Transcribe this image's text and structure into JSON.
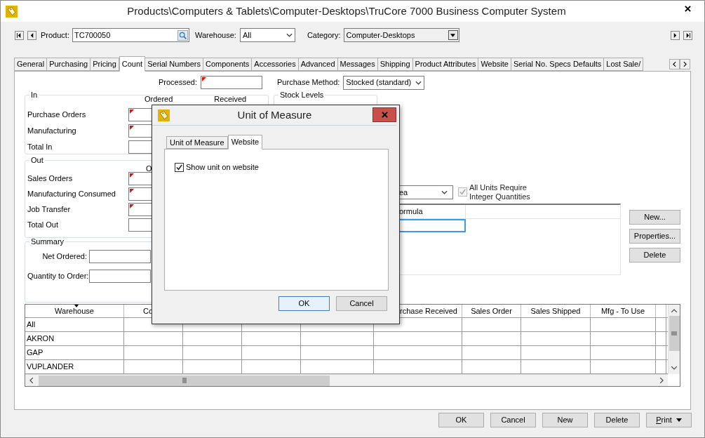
{
  "window": {
    "title": "Products\\Computers & Tablets\\Computer-Desktops\\TruCore 7000 Business Computer System"
  },
  "toolbar": {
    "product_label": "Product:",
    "product_value": "TC700050",
    "warehouse_label": "Warehouse:",
    "warehouse_value": "All",
    "category_label": "Category:",
    "category_value": "Computer-Desktops"
  },
  "tabs": [
    {
      "label": "General",
      "selected": false
    },
    {
      "label": "Purchasing",
      "selected": false
    },
    {
      "label": "Pricing",
      "selected": false
    },
    {
      "label": "Count",
      "selected": true
    },
    {
      "label": "Serial Numbers",
      "selected": false
    },
    {
      "label": "Components",
      "selected": false
    },
    {
      "label": "Accessories",
      "selected": false
    },
    {
      "label": "Advanced",
      "selected": false
    },
    {
      "label": "Messages",
      "selected": false
    },
    {
      "label": "Shipping",
      "selected": false
    },
    {
      "label": "Product Attributes",
      "selected": false
    },
    {
      "label": "Website",
      "selected": false
    },
    {
      "label": "Serial No. Specs Defaults",
      "selected": false
    },
    {
      "label": "Lost Sale/",
      "selected": false
    }
  ],
  "count": {
    "processed_label": "Processed:",
    "purchase_method_label": "Purchase Method:",
    "purchase_method_value": "Stocked (standard)",
    "in_group": {
      "title": "In",
      "headers": [
        "Ordered",
        "Received"
      ],
      "rows": [
        {
          "label": "Purchase Orders",
          "flagged": true
        },
        {
          "label": "Manufacturing",
          "flagged": true
        },
        {
          "label": "Total In",
          "flagged": false
        }
      ]
    },
    "out_group": {
      "title": "Out",
      "headers": [
        "O"
      ],
      "rows": [
        {
          "label": "Sales Orders",
          "flagged": true
        },
        {
          "label": "Manufacturing Consumed",
          "flagged": true
        },
        {
          "label": "Job Transfer",
          "flagged": true
        },
        {
          "label": "Total Out",
          "flagged": false
        }
      ]
    },
    "summary": {
      "title": "Summary",
      "fields": [
        {
          "label": "Net Ordered:"
        },
        {
          "label": "Quantity to Order:"
        }
      ]
    },
    "stock_levels": {
      "title": "Stock Levels"
    },
    "unit_value": "ea",
    "integer_units": {
      "label_lines": [
        "All Units Require",
        "Integer Quantities"
      ],
      "checked": true,
      "disabled": true
    },
    "units_grid": {
      "header": "ormula"
    },
    "side_buttons": [
      "New...",
      "Properties...",
      "Delete"
    ]
  },
  "warehouse_table": {
    "columns": [
      {
        "label": "Warehouse",
        "sorted": true
      },
      {
        "label": "Co"
      },
      {},
      {},
      {},
      {
        "label": "rchase Received"
      },
      {
        "label": "Sales Order"
      },
      {
        "label": "Sales Shipped"
      },
      {
        "label": "Mfg - To Use"
      },
      {}
    ],
    "rows": [
      "All",
      "AKRON",
      "GAP",
      "VUPLANDER"
    ]
  },
  "footer_buttons": [
    {
      "label": "OK",
      "kind": "plain"
    },
    {
      "label": "Cancel",
      "kind": "plain"
    },
    {
      "label": "New",
      "kind": "plain"
    },
    {
      "label": "Delete",
      "kind": "plain"
    },
    {
      "label": "Print",
      "kind": "menu"
    }
  ],
  "dialog": {
    "title": "Unit of Measure",
    "tabs": [
      {
        "label": "Unit of Measure",
        "selected": false
      },
      {
        "label": "Website",
        "selected": true
      }
    ],
    "checkbox": {
      "label": "Show unit on website",
      "checked": true
    },
    "buttons": [
      {
        "label": "OK",
        "default": true
      },
      {
        "label": "Cancel",
        "default": false
      }
    ]
  }
}
